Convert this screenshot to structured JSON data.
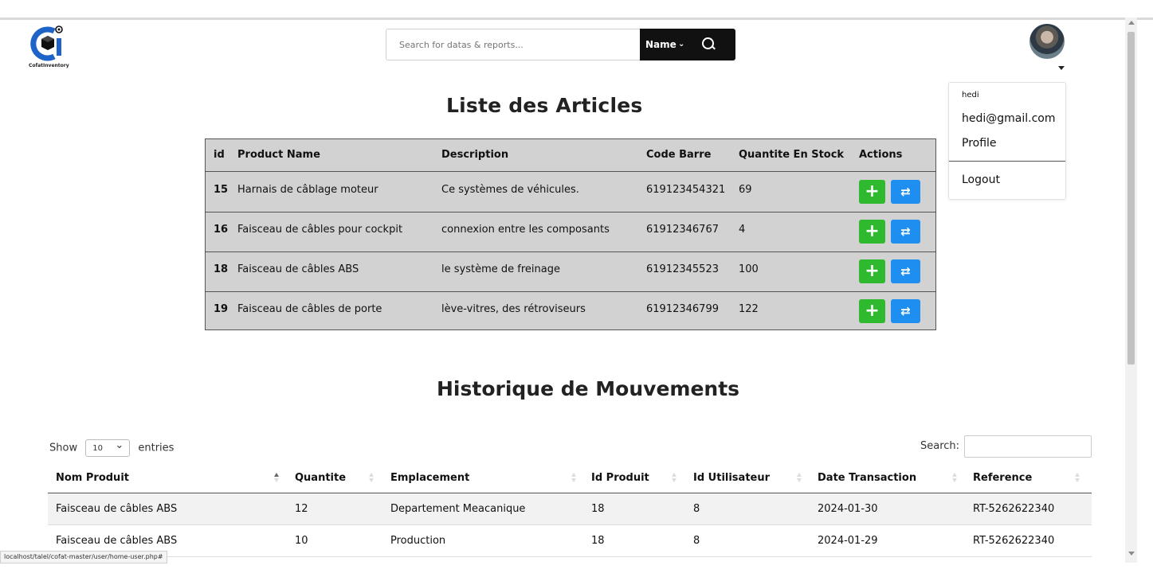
{
  "header": {
    "logo_text": "CofatInventory",
    "search_placeholder": "Search for datas & reports...",
    "search_filter": "Name",
    "user_menu": {
      "username": "hedi",
      "email": "hedi@gmail.com",
      "profile": "Profile",
      "logout": "Logout"
    }
  },
  "articles": {
    "title": "Liste des Articles",
    "columns": [
      "id",
      "Product Name",
      "Description",
      "Code Barre",
      "Quantite En Stock",
      "Actions"
    ],
    "rows": [
      {
        "id": "15",
        "name": "Harnais de câblage moteur",
        "desc": "Ce systèmes de véhicules.",
        "code": "619123454321",
        "qty": "69"
      },
      {
        "id": "16",
        "name": "Faisceau de câbles pour cockpit",
        "desc": "connexion entre les composants",
        "code": "61912346767",
        "qty": "4"
      },
      {
        "id": "18",
        "name": "Faisceau de câbles ABS",
        "desc": "le système de freinage",
        "code": "61912345523",
        "qty": "100"
      },
      {
        "id": "19",
        "name": "Faisceau de câbles de porte",
        "desc": "lève-vitres, des rétroviseurs",
        "code": "61912346799",
        "qty": "122"
      }
    ],
    "add_symbol": "+",
    "move_symbol": "⇄"
  },
  "history": {
    "title": "Historique de Mouvements",
    "show_label": "Show",
    "entries_value": "10",
    "entries_label": "entries",
    "search_label": "Search:",
    "columns": [
      "Nom Produit",
      "Quantite",
      "Emplacement",
      "Id Produit",
      "Id Utilisateur",
      "Date Transaction",
      "Reference"
    ],
    "rows": [
      {
        "nom": "Faisceau de câbles ABS",
        "qte": "12",
        "emp": "Departement Meacanique",
        "idp": "18",
        "idu": "8",
        "date": "2024-01-30",
        "ref": "RT-5262622340"
      },
      {
        "nom": "Faisceau de câbles ABS",
        "qte": "10",
        "emp": "Production",
        "idp": "18",
        "idu": "8",
        "date": "2024-01-29",
        "ref": "RT-5262622340"
      }
    ]
  },
  "status_url": "localhost/talel/cofat-master/user/home-user.php#"
}
